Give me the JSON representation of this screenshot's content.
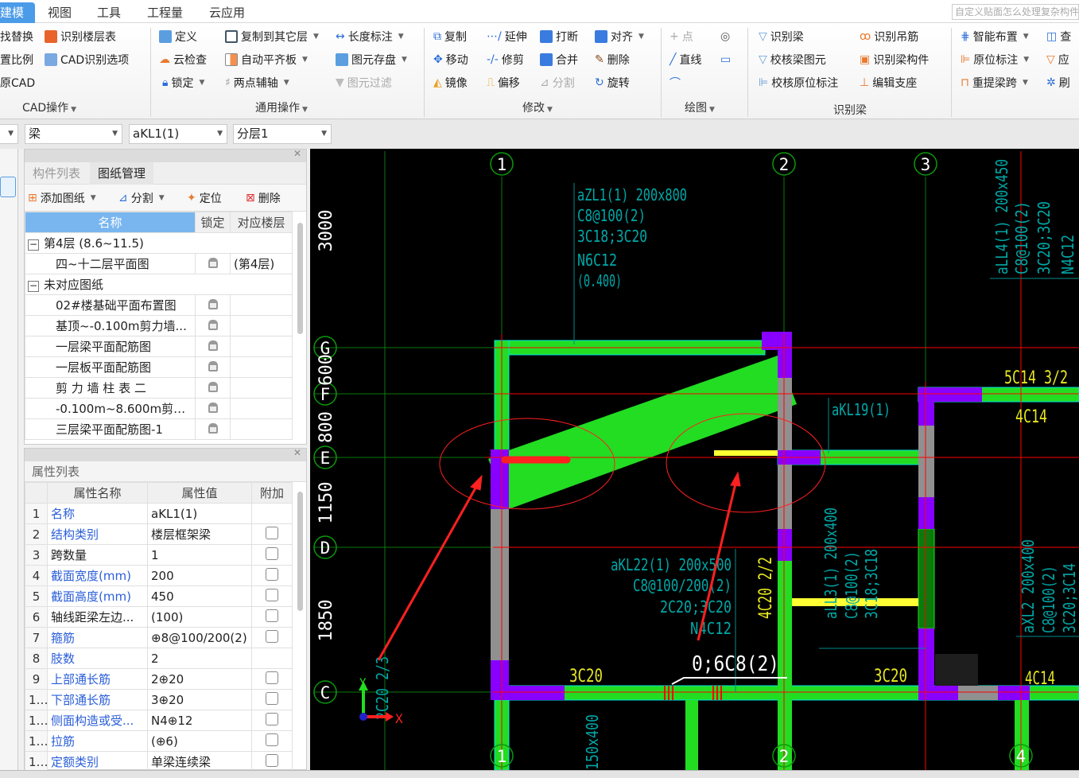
{
  "menu": {
    "tabs": [
      "建模",
      "视图",
      "工具",
      "工程量",
      "云应用"
    ],
    "active": "建模",
    "search_placeholder": "自定义贴面怎么处理复杂构件"
  },
  "ribbon": {
    "cad_ops": {
      "items": [
        "找替换",
        "识别楼层表",
        "置比例",
        "CAD识别选项",
        "原CAD"
      ],
      "group": "CAD操作"
    },
    "general_ops": {
      "items": [
        "定义",
        "复制到其它层",
        "长度标注",
        "云检查",
        "自动平齐板",
        "图元存盘",
        "锁定",
        "两点辅轴",
        "图元过滤"
      ],
      "group": "通用操作"
    },
    "modify": {
      "items": [
        "复制",
        "延伸",
        "打断",
        "对齐",
        "移动",
        "修剪",
        "合并",
        "删除",
        "镜像",
        "偏移",
        "分割",
        "旋转"
      ],
      "group": "修改"
    },
    "draw": {
      "items": [
        "点",
        "直线"
      ],
      "group": "绘图"
    },
    "recognize_beam": {
      "items": [
        "识别梁",
        "识别吊筋",
        "校核梁图元",
        "识别梁构件",
        "校核原位标注",
        "编辑支座"
      ],
      "group": "识别梁"
    },
    "beam_ops": {
      "items": [
        "智能布置",
        "查",
        "原位标注",
        "应",
        "重提梁跨",
        "刷"
      ]
    }
  },
  "selectors": {
    "category": "梁",
    "component": "aKL1(1)",
    "layer": "分层1"
  },
  "drawing_panel": {
    "tabs": [
      "构件列表",
      "图纸管理"
    ],
    "active_tab": "图纸管理",
    "tools": [
      "添加图纸",
      "分割",
      "定位",
      "删除"
    ],
    "columns": [
      "名称",
      "锁定",
      "对应楼层"
    ],
    "rows": [
      {
        "name": "第4层 (8.6~11.5)",
        "group": true,
        "floor": ""
      },
      {
        "name": "四~十二层平面图",
        "floor": "(第4层)"
      },
      {
        "name": "未对应图纸",
        "group": true,
        "floor": ""
      },
      {
        "name": "02#楼基础平面布置图",
        "floor": ""
      },
      {
        "name": "基顶~-0.100m剪力墙...",
        "floor": ""
      },
      {
        "name": "一层梁平面配筋图",
        "floor": ""
      },
      {
        "name": "一层板平面配筋图",
        "floor": ""
      },
      {
        "name": "剪 力 墙  柱 表 二",
        "floor": ""
      },
      {
        "name": "-0.100m~8.600m剪力...",
        "floor": ""
      },
      {
        "name": "三层梁平面配筋图-1",
        "floor": ""
      }
    ]
  },
  "property_panel": {
    "title": "属性列表",
    "columns": [
      "属性名称",
      "属性值",
      "附加"
    ],
    "rows": [
      {
        "n": "1",
        "name": "名称",
        "value": "aKL1(1)",
        "blue": true,
        "cb": false
      },
      {
        "n": "2",
        "name": "结构类别",
        "value": "楼层框架梁",
        "blue": true,
        "cb": true
      },
      {
        "n": "3",
        "name": "跨数量",
        "value": "1",
        "blue": false,
        "cb": true
      },
      {
        "n": "4",
        "name": "截面宽度(mm)",
        "value": "200",
        "blue": true,
        "cb": true
      },
      {
        "n": "5",
        "name": "截面高度(mm)",
        "value": "450",
        "blue": true,
        "cb": true
      },
      {
        "n": "6",
        "name": "轴线距梁左边...",
        "value": "(100)",
        "blue": false,
        "cb": true
      },
      {
        "n": "7",
        "name": "箍筋",
        "value": "⊕8@100/200(2)",
        "blue": true,
        "cb": true
      },
      {
        "n": "8",
        "name": "肢数",
        "value": "2",
        "blue": true,
        "cb": false
      },
      {
        "n": "9",
        "name": "上部通长筋",
        "value": "2⊕20",
        "blue": true,
        "cb": true
      },
      {
        "n": "10",
        "name": "下部通长筋",
        "value": "3⊕20",
        "blue": true,
        "cb": true
      },
      {
        "n": "11",
        "name": "侧面构造或受...",
        "value": "N4⊕12",
        "blue": true,
        "cb": true
      },
      {
        "n": "12",
        "name": "拉筋",
        "value": "(⊕6)",
        "blue": true,
        "cb": true
      },
      {
        "n": "13",
        "name": "定额类别",
        "value": "单梁连续梁",
        "blue": true,
        "cb": true
      }
    ]
  },
  "cad": {
    "axes_top": [
      "1",
      "2",
      "3"
    ],
    "axes_bottom": [
      "1",
      "2",
      "4"
    ],
    "axes_left": [
      "G",
      "F",
      "E",
      "D",
      "C"
    ],
    "dimensions": [
      "3000",
      "600",
      "800",
      "1150",
      "1850"
    ],
    "annotations": {
      "azl1": [
        "aZL1(1) 200x800",
        "C8@100(2)",
        "3C18;3C20",
        "N6C12",
        "(0.400)"
      ],
      "all4": [
        "aLL4(1) 200x450",
        "C8@100(2)",
        "3C20;3C20",
        "N4C12"
      ],
      "akl19": "aKL19(1)",
      "akl22": [
        "aKL22(1) 200x500",
        "C8@100/200(2)",
        "2C20;3C20",
        "N4C12"
      ],
      "all3": [
        "aLL3(1) 200x400",
        "C8@100(2)",
        "3C18;3C18"
      ],
      "axl2": [
        "aXL2 200x400",
        "C8@100(2)",
        "3C20;3C14"
      ],
      "yellow": [
        "5C14 3/2",
        "4C14",
        "3C20",
        "3C20",
        "4C14",
        "4C20 2/2"
      ],
      "stirrup": "0;6C8(2)",
      "left_partial": [
        "2C20 2/3",
        "150x400"
      ]
    },
    "ucs": {
      "x": "X",
      "y": "Y"
    },
    "colors": {
      "beam": "#22dd22",
      "column": "#8800ff",
      "wall": "#909090",
      "axis": "#ff0000",
      "text": "#008b8b",
      "highlight": "#ffff33"
    }
  }
}
